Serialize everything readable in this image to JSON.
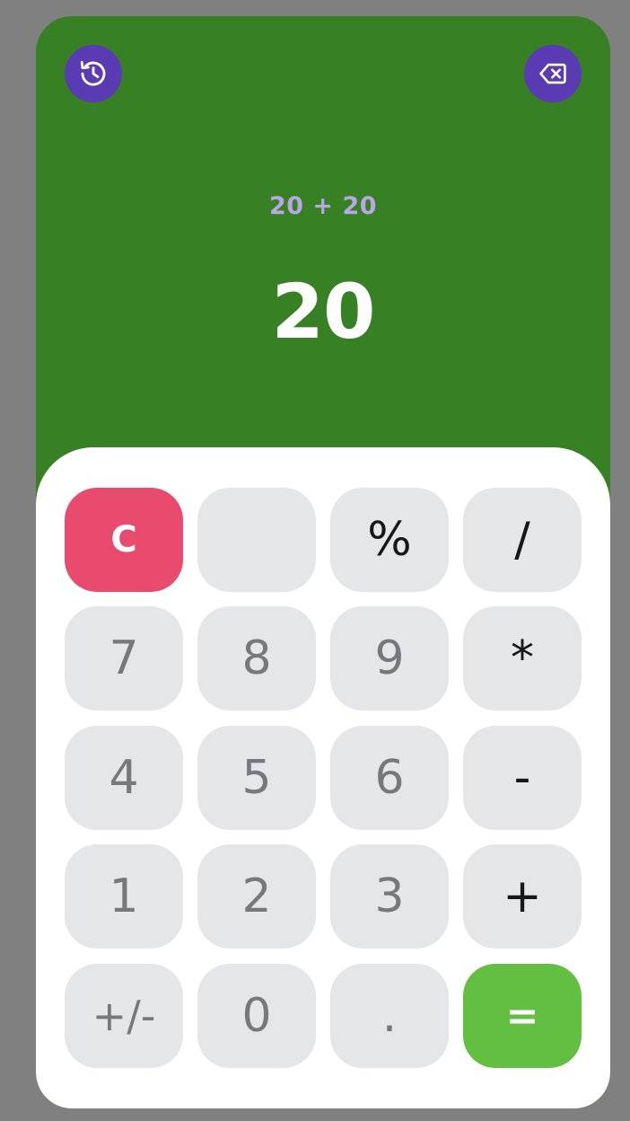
{
  "display": {
    "expression": "20 + 20",
    "result": "20"
  },
  "icons": {
    "history": "history-icon",
    "backspace": "backspace-icon"
  },
  "keys": {
    "clear": "C",
    "blank": "",
    "percent": "%",
    "divide": "/",
    "seven": "7",
    "eight": "8",
    "nine": "9",
    "multiply": "*",
    "four": "4",
    "five": "5",
    "six": "6",
    "subtract": "-",
    "one": "1",
    "two": "2",
    "three": "3",
    "add": "+",
    "negate": "+/-",
    "zero": "0",
    "decimal": ".",
    "equals": "="
  },
  "colors": {
    "display_background": "#388024",
    "icon_button": "#5a3bb3",
    "clear_key": "#e84b6d",
    "equals_key": "#62bf41",
    "key_background": "#e5e6e8",
    "expression_text": "#b9a6e6"
  }
}
